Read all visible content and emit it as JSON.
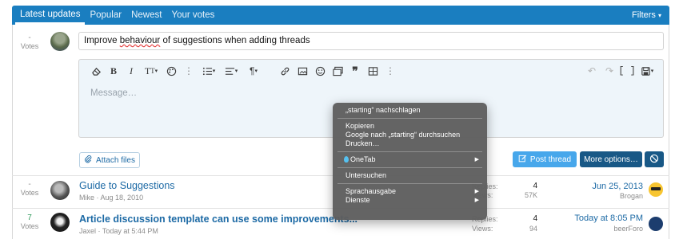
{
  "tabs": [
    {
      "label": "Latest updates"
    },
    {
      "label": "Popular"
    },
    {
      "label": "Newest"
    },
    {
      "label": "Your votes"
    }
  ],
  "filters_label": "Filters",
  "new_thread": {
    "votes_num": "-",
    "votes_label": "Votes",
    "title_value_part1": "Improve ",
    "title_value_misspelled": "behaviour",
    "title_value_part2": " of suggestions when adding threads",
    "message_placeholder": "Message…"
  },
  "buttons": {
    "attach": "Attach files",
    "post": "Post thread",
    "more": "More options…"
  },
  "threads": [
    {
      "votes_num": "-",
      "votes_label": "Votes",
      "title": "Guide to Suggestions",
      "author": "Mike",
      "date": "Aug 18, 2010",
      "replies_label": "Replies:",
      "replies": "4",
      "views_label": "Views:",
      "views": "57K",
      "latest_date": "Jun 25, 2013",
      "latest_user": "Brogan"
    },
    {
      "votes_num": "7",
      "votes_label": "Votes",
      "title": "Article discussion template can use some improvements...",
      "author": "Jaxel",
      "date": "Today at 5:44 PM",
      "replies_label": "Replies:",
      "replies": "4",
      "views_label": "Views:",
      "views": "94",
      "latest_date": "Today at 8:05 PM",
      "latest_user": "beerForo"
    }
  ],
  "context_menu": {
    "lookup": "„starting“ nachschlagen",
    "copy": "Kopieren",
    "google": "Google nach „starting“ durchsuchen",
    "print": "Drucken…",
    "onetab": "OneTab",
    "inspect": "Untersuchen",
    "speech": "Sprachausgabe",
    "services": "Dienste"
  },
  "colors": {
    "tab_bar": "#1a7ec0",
    "link": "#1d6aa5",
    "post_button": "#47a7eb",
    "dark_button": "#185886"
  }
}
